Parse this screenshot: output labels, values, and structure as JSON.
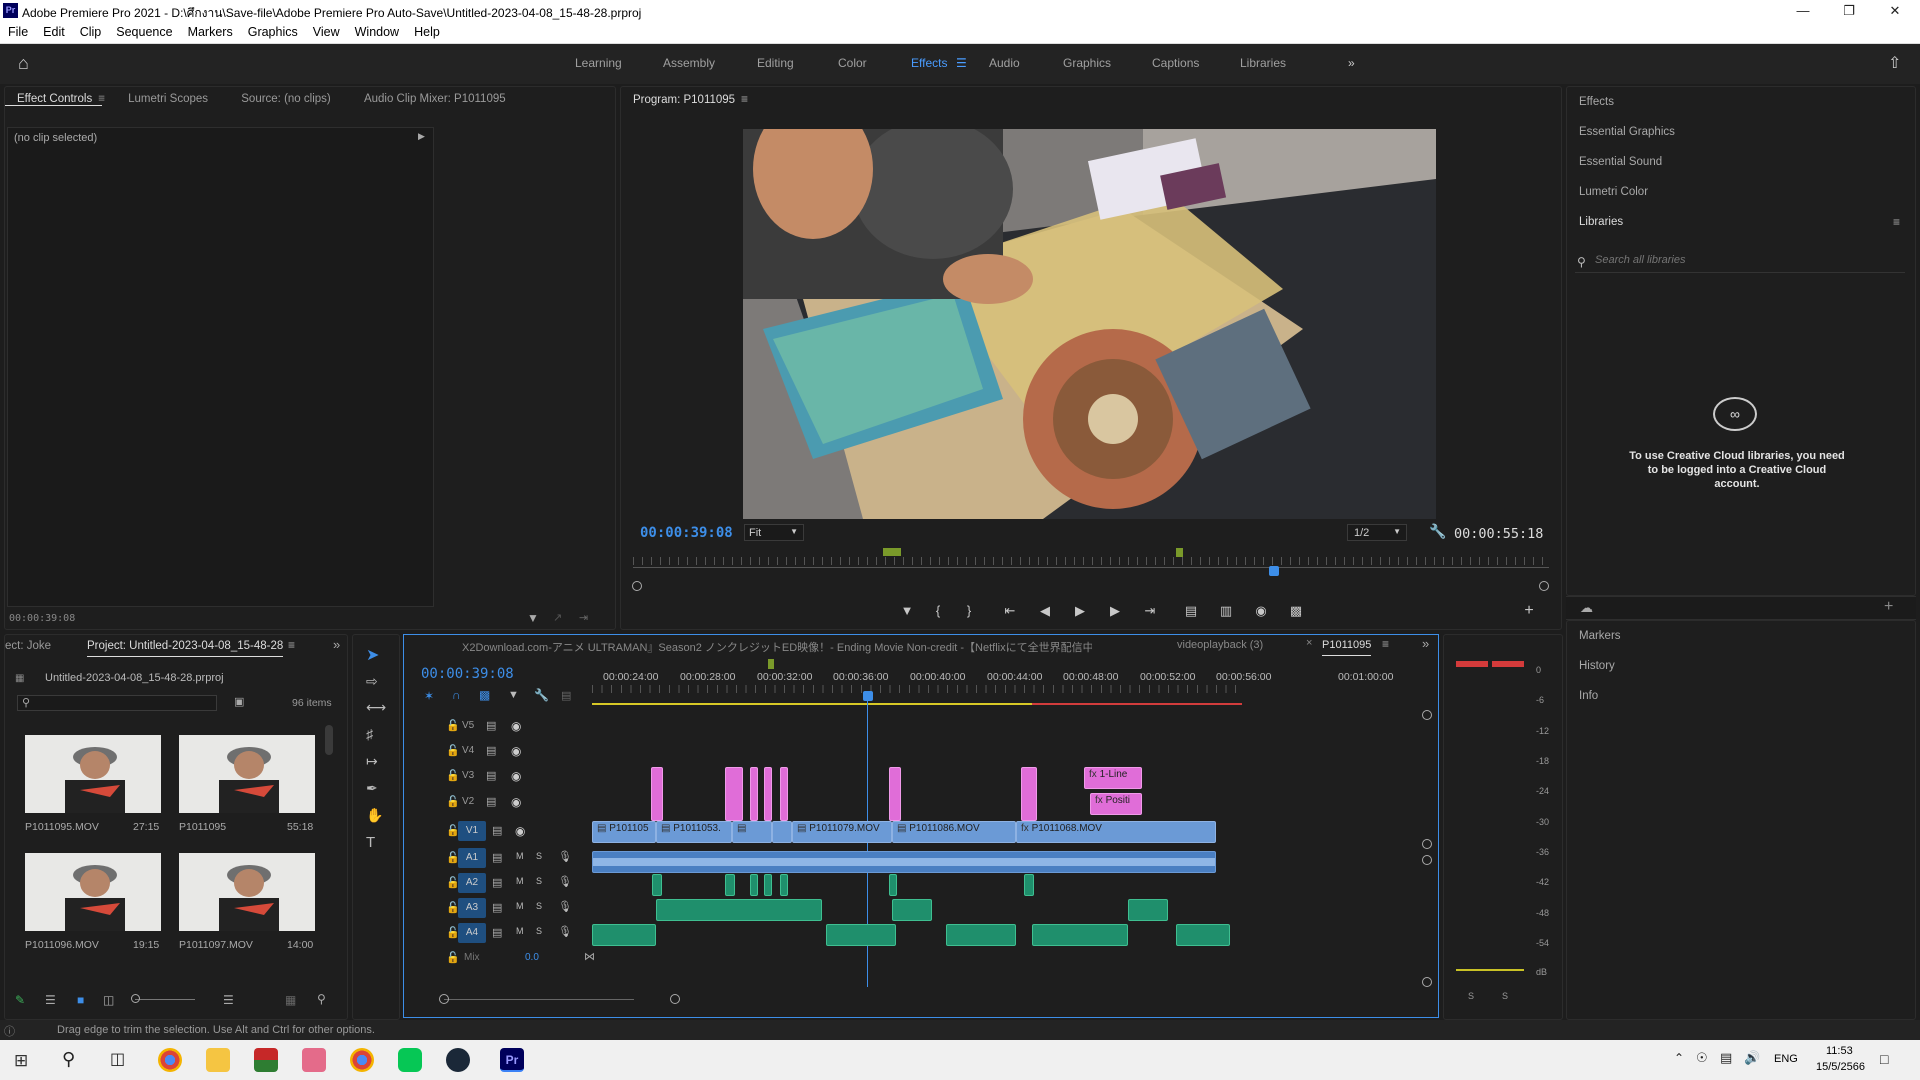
{
  "titlebar": {
    "app_icon": "Pr",
    "title": "Adobe Premiere Pro 2021 - D:\\ศึกงาน\\Save-file\\Adobe Premiere Pro Auto-Save\\Untitled-2023-04-08_15-48-28.prproj"
  },
  "menu": [
    "File",
    "Edit",
    "Clip",
    "Sequence",
    "Markers",
    "Graphics",
    "View",
    "Window",
    "Help"
  ],
  "workspaces": [
    "Learning",
    "Assembly",
    "Editing",
    "Color",
    "Effects",
    "Audio",
    "Graphics",
    "Captions",
    "Libraries"
  ],
  "active_workspace": "Effects",
  "left_panel": {
    "tabs": [
      "Effect Controls",
      "Lumetri Scopes",
      "Source: (no clips)",
      "Audio Clip Mixer: P1011095"
    ],
    "no_clip": "(no clip selected)",
    "timecode": "00:00:39:08"
  },
  "program": {
    "title": "Program: P1011095",
    "timecode_left": "00:00:39:08",
    "timecode_right": "00:00:55:18",
    "fit": "Fit",
    "resolution": "1/2"
  },
  "right_panel": {
    "items": [
      "Effects",
      "Essential Graphics",
      "Essential Sound",
      "Lumetri Color",
      "Libraries"
    ],
    "search_placeholder": "Search all libraries",
    "cc_message": "To use Creative Cloud libraries, you need to be logged into a Creative Cloud account.",
    "lower_items": [
      "Markers",
      "History",
      "Info"
    ]
  },
  "project": {
    "tab_left": "ect: Joke",
    "tab": "Project: Untitled-2023-04-08_15-48-28",
    "filename": "Untitled-2023-04-08_15-48-28.prproj",
    "items_count": "96 items",
    "thumbs": [
      {
        "name": "P1011095.MOV",
        "dur": "27:15"
      },
      {
        "name": "P1011095",
        "dur": "55:18"
      },
      {
        "name": "P1011096.MOV",
        "dur": "19:15"
      },
      {
        "name": "P1011097.MOV",
        "dur": "14:00"
      }
    ]
  },
  "timeline": {
    "tabs": [
      "X2Download.com-アニメ ULTRAMAN』Season2 ノンクレジットED映像！- Ending Movie Non-credit -【Netflixにて全世界配信中】",
      "videoplayback (3)",
      "P1011095"
    ],
    "timecode": "00:00:39:08",
    "ruler": [
      "00:00:24:00",
      "00:00:28:00",
      "00:00:32:00",
      "00:00:36:00",
      "00:00:40:00",
      "00:00:44:00",
      "00:00:48:00",
      "00:00:52:00",
      "00:00:56:00",
      "00:01:00:00"
    ],
    "video_tracks": [
      "V5",
      "V4",
      "V3",
      "V2",
      "V1"
    ],
    "audio_tracks": [
      "A1",
      "A2",
      "A3",
      "A4"
    ],
    "mix_label": "Mix",
    "mix_value": "0.0",
    "v1_clips": [
      "P101105",
      "P1011053.",
      "P1011079.MOV",
      "P1011086.MOV",
      "P1011068.MOV"
    ],
    "graphic_clips": [
      "1-Line",
      "Positi"
    ]
  },
  "meter_scale": [
    "0",
    "-6",
    "-12",
    "-18",
    "-24",
    "-30",
    "-36",
    "-42",
    "-48",
    "-54",
    "dB"
  ],
  "meter_solo": [
    "S",
    "S"
  ],
  "statusbar": "Drag edge to trim the selection. Use Alt and Ctrl for other options.",
  "taskbar": {
    "lang": "ENG",
    "time": "11:53",
    "date": "15/5/2566"
  }
}
